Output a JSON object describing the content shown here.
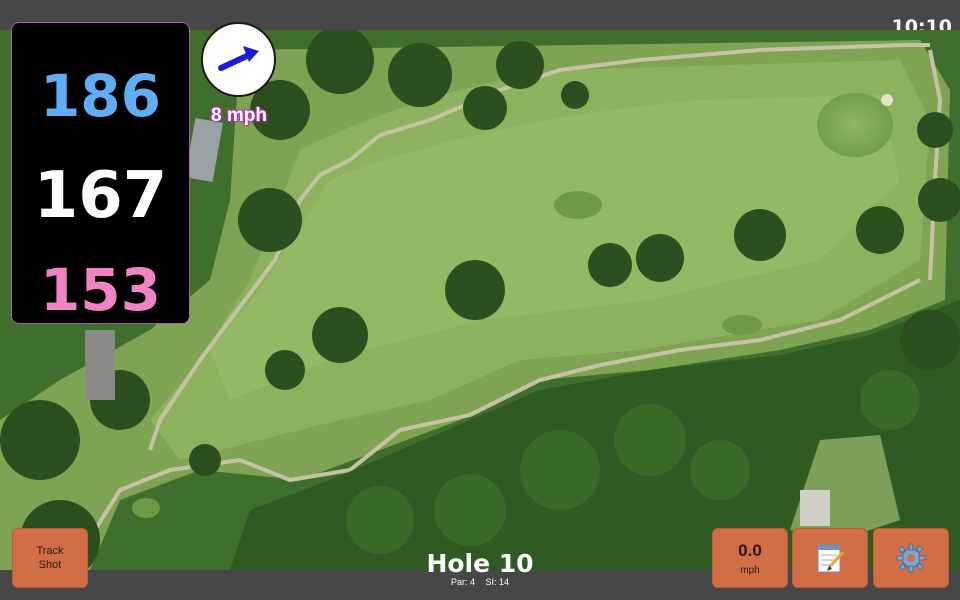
{
  "status_bar": {
    "time": "10:10"
  },
  "yardage": {
    "back": "186",
    "middle": "167",
    "front": "153"
  },
  "wind": {
    "speed_label": "8 mph",
    "direction_icon": "arrow-icon"
  },
  "buttons": {
    "track_shot": "Track\nShot",
    "speed_value": "0.0",
    "speed_unit": "mph",
    "notes_icon": "notepad-icon",
    "settings_icon": "gear-icon"
  },
  "hole": {
    "title": "Hole 10",
    "par": "Par: 4",
    "si": "SI: 14"
  },
  "colors": {
    "back": "#5faef5",
    "middle": "#ffffff",
    "front": "#f083c4",
    "button": "#d16e45"
  }
}
